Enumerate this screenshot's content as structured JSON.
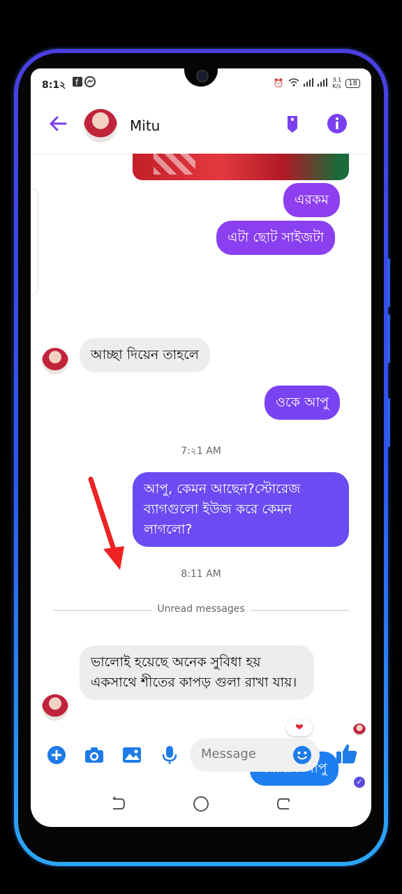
{
  "status": {
    "time": "8:1২",
    "network_speed": "3.1\nK/s",
    "battery": "18"
  },
  "header": {
    "contact_name": "Mitu"
  },
  "messages": {
    "m1": "এরকম",
    "m2": "এটা ছোট সাইজটা",
    "m3": "আচ্ছা দিয়েন তাহলে",
    "m4": "ওকে আপু",
    "time1": "7:২1 AM",
    "m5": "আপু, কেমন আছেন?স্টোরেজ ব্যাগগুলো ইউজ করে কেমন লাগলো?",
    "time2": "8:11 AM",
    "unread": "Unread messages",
    "m6": "ভালোই হয়েছে অনেক সুবিধা হয় একসাথে শীতের কাপড় গুলা রাখা যায়।",
    "reaction": "❤",
    "m7": "ধন্যবাদ আপু"
  },
  "composer": {
    "placeholder": "Message"
  },
  "colors": {
    "accent": "#7a3ff0",
    "bubble_purple": "#8f3ff0",
    "bubble_violet": "#6a4cf2",
    "bubble_blue": "#1e7ef0",
    "icon_blue": "#1f7be8"
  }
}
